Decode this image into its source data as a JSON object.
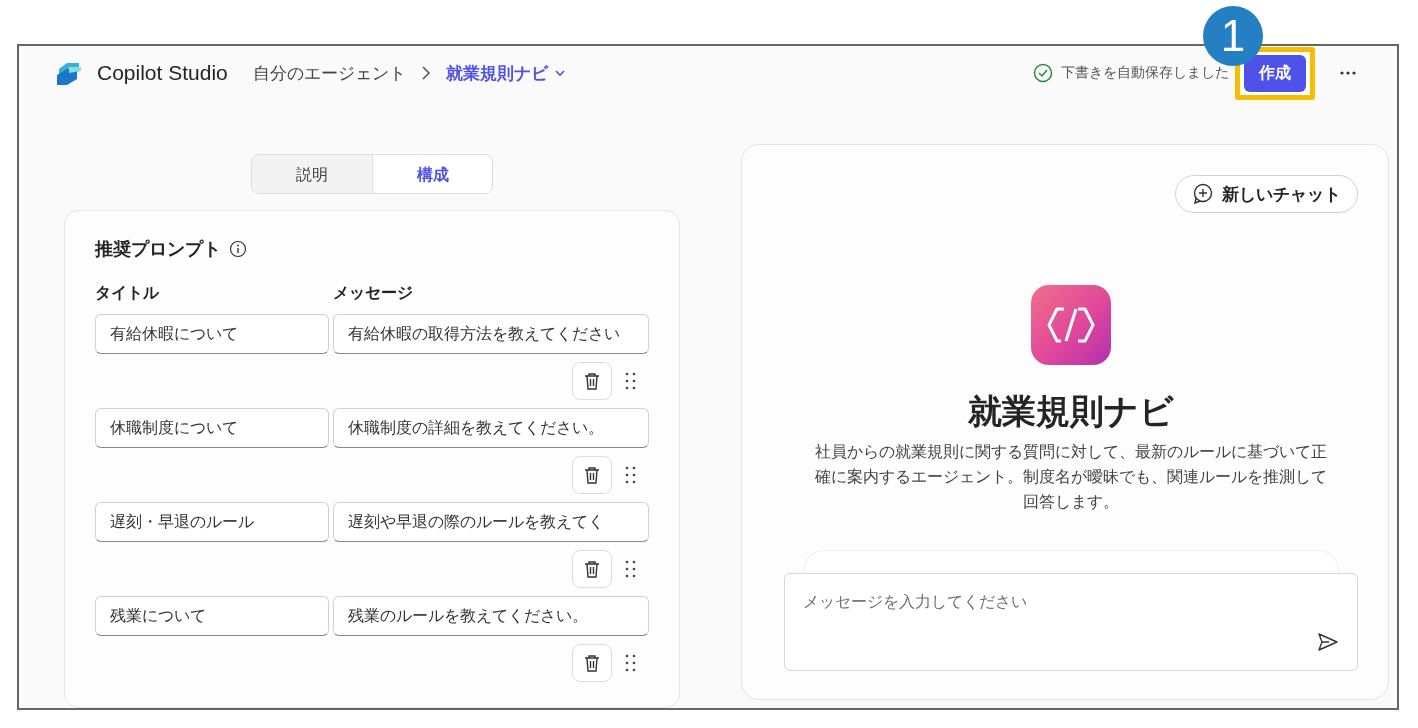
{
  "header": {
    "app_name": "Copilot Studio",
    "breadcrumb_parent": "自分のエージェント",
    "breadcrumb_current": "就業規則ナビ",
    "save_status": "下書きを自動保存しました",
    "create_button": "作成",
    "callout": "1"
  },
  "tabs": [
    {
      "label": "説明",
      "selected": false
    },
    {
      "label": "構成",
      "selected": true
    }
  ],
  "prompts": {
    "title": "推奨プロンプト",
    "columns": [
      "タイトル",
      "メッセージ"
    ],
    "rows": [
      {
        "title": "有給休暇について",
        "message": "有給休暇の取得方法を教えてください"
      },
      {
        "title": "休職制度について",
        "message": "休職制度の詳細を教えてください。"
      },
      {
        "title": "遅刻・早退のルール",
        "message": "遅刻や早退の際のルールを教えてく"
      },
      {
        "title": "残業について",
        "message": "残業のルールを教えてください。"
      }
    ]
  },
  "chat": {
    "new_chat": "新しいチャット",
    "agent_name": "就業規則ナビ",
    "description": "社員からの就業規則に関する質問に対して、最新のルールに基づいて正確に案内するエージェント。制度名が曖昧でも、関連ルールを推測して回答します。",
    "input_placeholder": "メッセージを入力してください"
  }
}
